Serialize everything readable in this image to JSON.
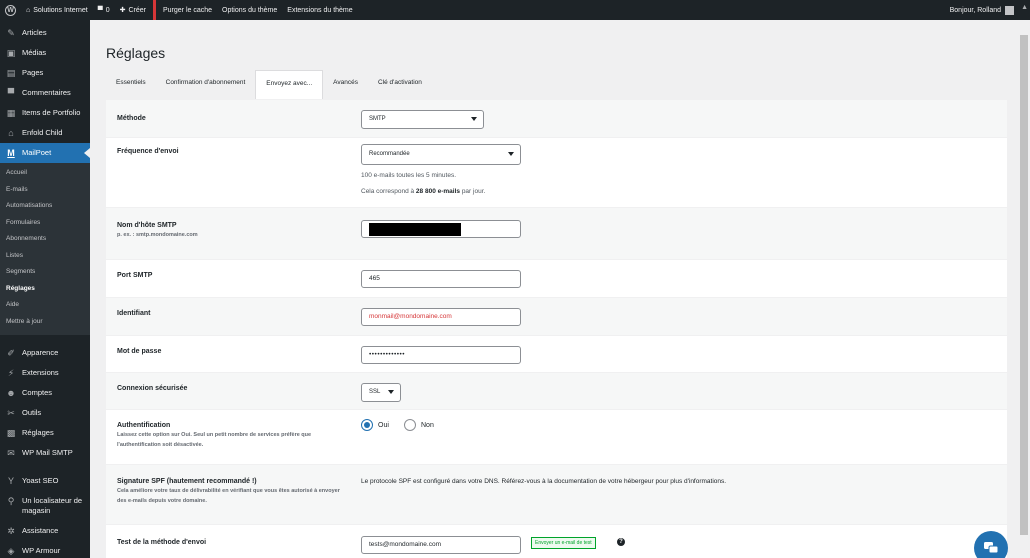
{
  "admin_bar": {
    "site_name": "Solutions Internet",
    "comments_count": "0",
    "new_label": "Créer",
    "purge_cache": "Purger le cache",
    "theme_options": "Options du thème",
    "theme_extensions": "Extensions du thème",
    "greeting": "Bonjour, Rolland"
  },
  "sidebar": {
    "items_top": [
      {
        "label": "Articles",
        "icon": "pin-icon"
      },
      {
        "label": "Médias",
        "icon": "media-icon"
      },
      {
        "label": "Pages",
        "icon": "page-icon"
      },
      {
        "label": "Commentaires",
        "icon": "comment-icon"
      },
      {
        "label": "Items de Portfolio",
        "icon": "portfolio-icon"
      },
      {
        "label": "Enfold Child",
        "icon": "home-icon"
      },
      {
        "label": "MailPoet",
        "icon": "mailpoet-icon"
      }
    ],
    "submenu": [
      "Accueil",
      "E-mails",
      "Automatisations",
      "Formulaires",
      "Abonnements",
      "Listes",
      "Segments",
      "Réglages",
      "Aide",
      "Mettre à jour"
    ],
    "items_bottom": [
      {
        "label": "Apparence",
        "icon": "brush-icon"
      },
      {
        "label": "Extensions",
        "icon": "plugin-icon"
      },
      {
        "label": "Comptes",
        "icon": "users-icon"
      },
      {
        "label": "Outils",
        "icon": "wrench-icon"
      },
      {
        "label": "Réglages",
        "icon": "settings-icon"
      },
      {
        "label": "WP Mail SMTP",
        "icon": "mail-smtp-icon"
      },
      {
        "label": "Yoast SEO",
        "icon": "yoast-icon"
      },
      {
        "label": "Un localisateur de magasin",
        "icon": "map-pin-icon"
      },
      {
        "label": "Assistance",
        "icon": "gear-icon"
      },
      {
        "label": "WP Armour",
        "icon": "shield-icon"
      }
    ]
  },
  "page": {
    "title": "Réglages",
    "tabs": [
      "Essentiels",
      "Confirmation d'abonnement",
      "Envoyez avec...",
      "Avancés",
      "Clé d'activation"
    ]
  },
  "form": {
    "method": {
      "label": "Méthode",
      "value": "SMTP"
    },
    "frequency": {
      "label": "Fréquence d'envoi",
      "value": "Recommandée",
      "help1": "100 e-mails toutes les 5 minutes.",
      "help2_prefix": "Cela correspond à ",
      "help2_bold": "28 800 e-mails",
      "help2_suffix": " par jour."
    },
    "smtp_host": {
      "label": "Nom d'hôte SMTP",
      "desc": "p. ex. : smtp.mondomaine.com"
    },
    "smtp_port": {
      "label": "Port SMTP",
      "value": "465"
    },
    "login": {
      "label": "Identifiant",
      "value": "monmail@mondomaine.com"
    },
    "password": {
      "label": "Mot de passe",
      "value": "•••••••••••••"
    },
    "secure": {
      "label": "Connexion sécurisée",
      "value": "SSL"
    },
    "auth": {
      "label": "Authentification",
      "desc": "Laissez cette option sur Oui. Seul un petit nombre de services préfère que l'authentification soit désactivée.",
      "yes": "Oui",
      "no": "Non",
      "selected": "Oui"
    },
    "spf": {
      "label": "Signature SPF (hautement recommandé !)",
      "desc": "Cela améliore votre taux de délivrabilité en vérifiant que vous êtes autorisé à envoyer des e-mails depuis votre domaine.",
      "text": "Le protocole SPF est configuré dans votre DNS. Référez-vous à la documentation de votre hébergeur pour plus d'informations."
    },
    "test": {
      "label": "Test de la méthode d'envoi",
      "value": "tests@mondomaine.com",
      "button": "Envoyer un e-mail de test"
    }
  },
  "colors": {
    "admin_dark": "#1d2327",
    "accent_blue": "#2271b1",
    "error_red": "#d63638",
    "success_green": "#00a32a"
  }
}
